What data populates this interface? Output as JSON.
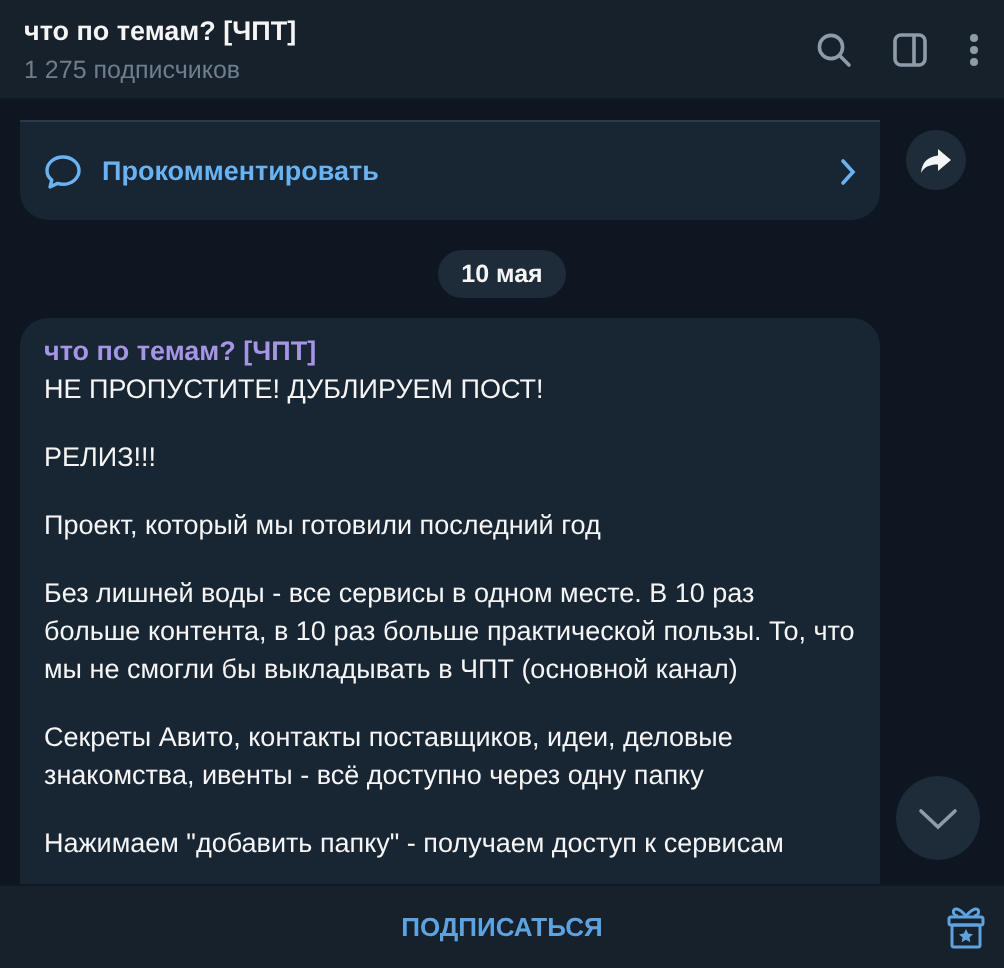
{
  "header": {
    "title": "что по темам? [ЧПТ]",
    "subtitle": "1 275 подписчиков"
  },
  "previous_post": {
    "comment_label": "Прокомментировать"
  },
  "date_separator": "10 мая",
  "post": {
    "author": "что по темам? [ЧПТ]",
    "paragraphs": [
      "НЕ ПРОПУСТИТЕ! ДУБЛИРУЕМ ПОСТ!",
      "РЕЛИЗ!!!",
      "Проект, который мы готовили последний год",
      "Без лишней воды - все сервисы в одном месте. В 10 раз больше контента, в 10 раз больше практической пользы. То, что мы не смогли бы выкладывать в ЧПТ (основной канал)",
      "Секреты Авито, контакты поставщиков, идеи, деловые знакомства, ивенты - всё доступно через одну папку",
      "Нажимаем \"добавить папку\" - получаем доступ к сервисам"
    ]
  },
  "footer": {
    "subscribe_label": "ПОДПИСАТЬСЯ"
  }
}
